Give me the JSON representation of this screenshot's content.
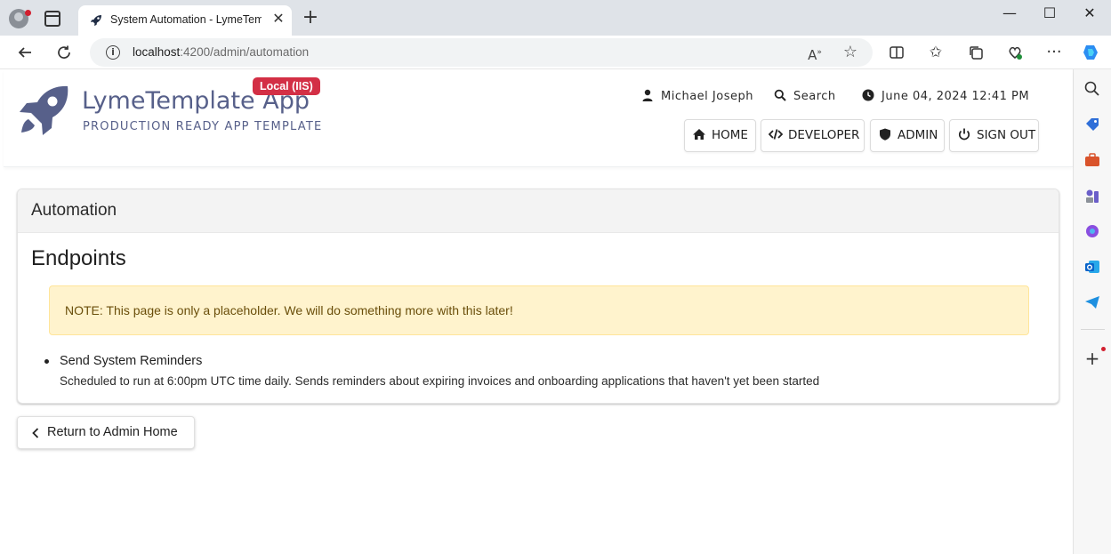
{
  "browser": {
    "tab_title": "System Automation - LymeTemplate App",
    "tab_close": "✕",
    "new_tab": "+",
    "url_host": "localhost",
    "url_path": ":4200/admin/automation",
    "window_controls": {
      "minimize": "—",
      "maximize": "☐",
      "close": "✕"
    }
  },
  "app": {
    "brand_title": "LymeTemplate App",
    "env_badge": "Local (IIS)",
    "brand_subtitle": "PRODUCTION READY APP TEMPLATE",
    "user_name": "Michael Joseph",
    "search_label": "Search",
    "datetime": "June 04, 2024 12:41 PM",
    "nav": [
      {
        "label": "HOME",
        "icon": "home-icon"
      },
      {
        "label": "DEVELOPER",
        "icon": "code-icon"
      },
      {
        "label": "ADMIN",
        "icon": "shield-icon"
      },
      {
        "label": "SIGN OUT",
        "icon": "power-icon"
      }
    ],
    "brand_color": "#57608a",
    "badge_color": "#d32f45"
  },
  "main": {
    "card_title": "Automation",
    "section_title": "Endpoints",
    "note": "NOTE: This page is only a placeholder. We will do something more with this later!",
    "endpoints": [
      {
        "name": "Send System Reminders",
        "description": "Scheduled to run at 6:00pm UTC time daily. Sends reminders about expiring invoices and onboarding applications that haven't yet been started"
      }
    ],
    "return_label": "Return to Admin Home"
  }
}
